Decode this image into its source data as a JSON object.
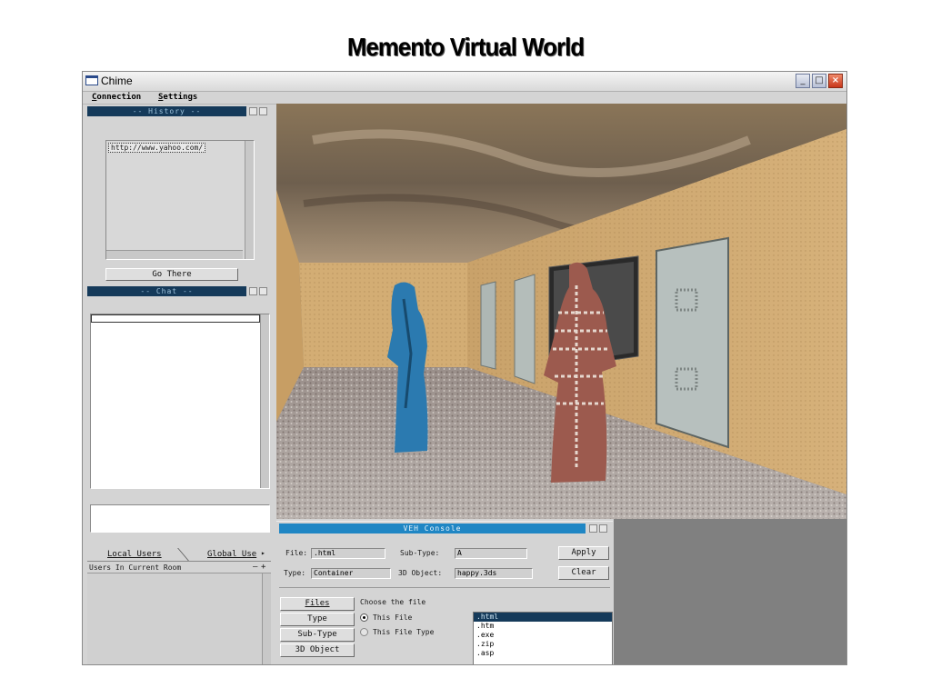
{
  "slide": {
    "title": "Memento Virtual World"
  },
  "window": {
    "title": "Chime",
    "controls": {
      "minimize": "_",
      "maximize": "□",
      "close": "×"
    }
  },
  "menu": [
    {
      "label": "Connection",
      "mnemonic": "C"
    },
    {
      "label": "Settings",
      "mnemonic": "S"
    }
  ],
  "history": {
    "title": "-- History --",
    "items": [
      "http://www.yahoo.com/"
    ],
    "go_button": "Go There"
  },
  "chat": {
    "title": "-- Chat --",
    "input_value": ""
  },
  "users": {
    "tabs": [
      {
        "label": "Local Users",
        "active": true
      },
      {
        "label": "Global Use",
        "active": false
      }
    ],
    "section_label": "Users In Current Room",
    "collapse": "–",
    "expand": "+"
  },
  "console": {
    "title": "VEH Console",
    "labels": {
      "file": "File:",
      "subtype": "Sub-Type:",
      "type": "Type:",
      "object": "3D Object:"
    },
    "values": {
      "file": ".html",
      "subtype": "A",
      "type": "Container",
      "object": "happy.3ds"
    },
    "apply_button": "Apply",
    "clear_button": "Clear",
    "side_buttons": [
      "Files",
      "Type",
      "Sub-Type",
      "3D Object"
    ],
    "section_title": "Choose the file",
    "radios": [
      {
        "label": "This File",
        "checked": true
      },
      {
        "label": "This File Type",
        "checked": false
      }
    ],
    "extensions": [
      ".html",
      ".htm",
      ".exe",
      ".zip",
      ".asp"
    ],
    "selected_extension": ".html"
  },
  "colors": {
    "panel_title_bg": "#153a5a",
    "panel_title_text": "#9ec3dc",
    "console_title_bg": "#1f86c4",
    "selection_bg": "#153a5a"
  }
}
